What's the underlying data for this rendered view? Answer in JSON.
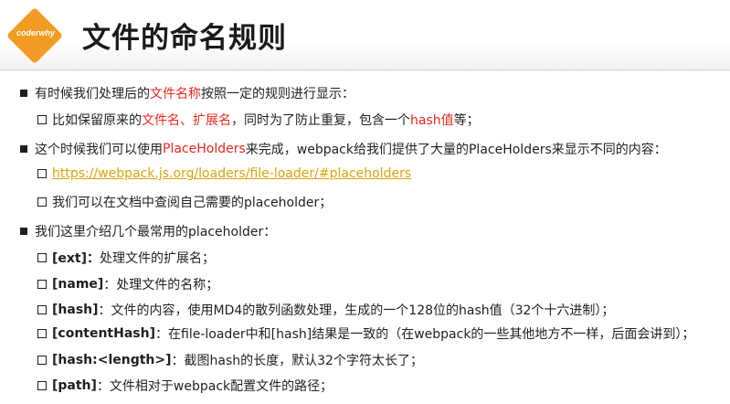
{
  "logo": {
    "text": "coderwhy",
    "color": "#f39c23"
  },
  "title": "文件的命名规则",
  "section1": {
    "p1": "有时候我们处理后的",
    "red1": "文件名称",
    "p2": "按照一定的规则进行显示：",
    "sub1": {
      "p1": "比如保留原来的",
      "red1": "文件名、扩展名",
      "p2": "，同时为了防止重复，包含一个",
      "red2": "hash值",
      "p3": "等；"
    }
  },
  "section2": {
    "p1": "这个时候我们可以使用",
    "red1": "PlaceHolders",
    "p2": "来完成，webpack给我们提供了大量的PlaceHolders来显示不同的内容：",
    "link": "https://webpack.js.org/loaders/file-loader/#placeholders",
    "sub2": "我们可以在文档中查阅自己需要的placeholder；"
  },
  "section3": {
    "intro": "我们这里介绍几个最常用的placeholder：",
    "items": [
      {
        "key": "[ext]：",
        "desc": " 处理文件的扩展名；"
      },
      {
        "key": "[name]",
        "desc": "：处理文件的名称；"
      },
      {
        "key": "[hash]",
        "desc": "：文件的内容，使用MD4的散列函数处理，生成的一个128位的hash值（32个十六进制）；"
      },
      {
        "key": "[contentHash]",
        "desc": "：在file-loader中和[hash]结果是一致的（在webpack的一些其他地方不一样，后面会讲到）；"
      },
      {
        "key": "[hash:<length>]",
        "desc": "：截图hash的长度，默认32个字符太长了；"
      },
      {
        "key": "[path]",
        "desc": "：文件相对于webpack配置文件的路径；"
      }
    ]
  },
  "colors": {
    "accent_red": "#e8291c",
    "link": "#d9a50c"
  }
}
